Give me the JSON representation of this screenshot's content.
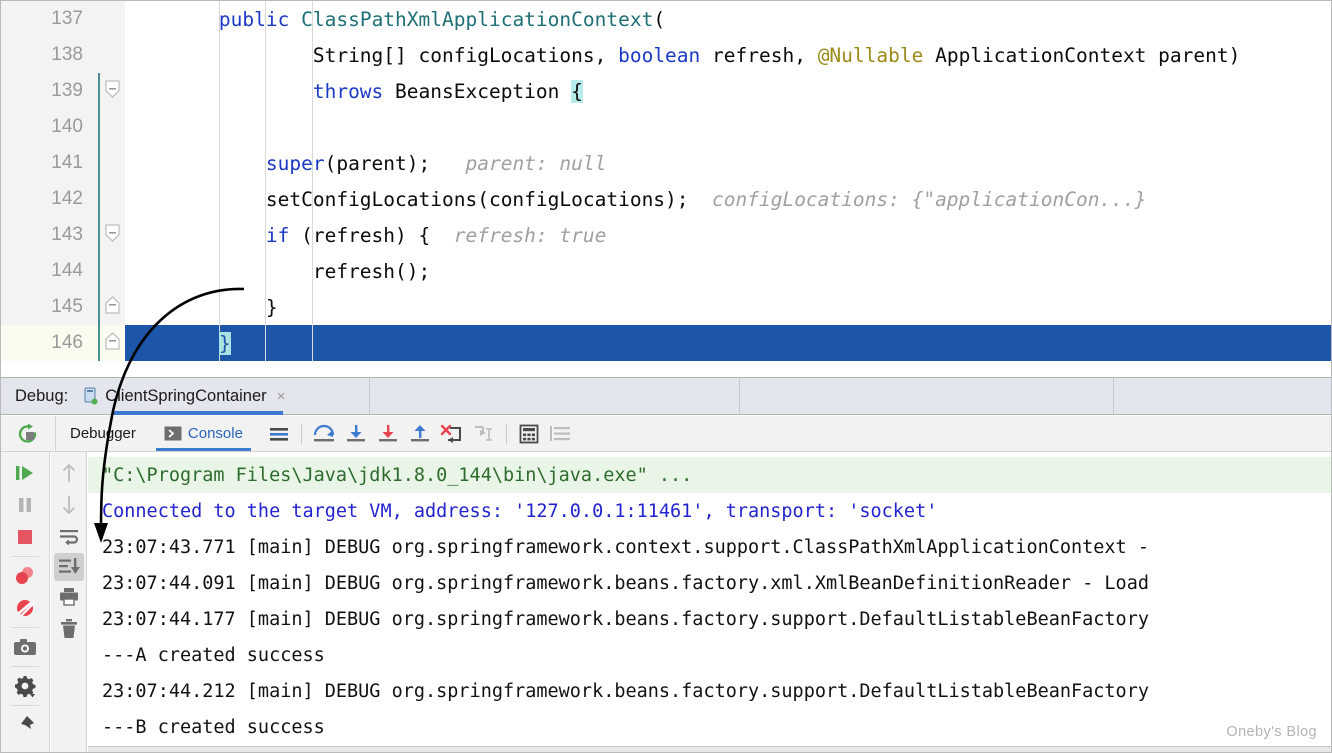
{
  "editor": {
    "lines": [
      {
        "num": "137",
        "fold": "none",
        "segments": [
          {
            "t": "        ",
            "c": "plain"
          },
          {
            "t": "public",
            "c": "kw"
          },
          {
            "t": " ",
            "c": "plain"
          },
          {
            "t": "ClassPathXmlApplicationContext",
            "c": "cls"
          },
          {
            "t": "(",
            "c": "plain"
          }
        ]
      },
      {
        "num": "138",
        "fold": "none",
        "segments": [
          {
            "t": "                ",
            "c": "plain"
          },
          {
            "t": "String[] configLocations, ",
            "c": "plain"
          },
          {
            "t": "boolean",
            "c": "kw"
          },
          {
            "t": " refresh, ",
            "c": "plain"
          },
          {
            "t": "@Nullable",
            "c": "ann"
          },
          {
            "t": " ApplicationContext parent)",
            "c": "plain"
          }
        ]
      },
      {
        "num": "139",
        "fold": "start",
        "segments": [
          {
            "t": "                ",
            "c": "plain"
          },
          {
            "t": "throws",
            "c": "kw"
          },
          {
            "t": " BeansException ",
            "c": "plain"
          },
          {
            "t": "{",
            "c": "brace-hl"
          }
        ]
      },
      {
        "num": "140",
        "fold": "none",
        "segments": [
          {
            "t": "",
            "c": "plain"
          }
        ]
      },
      {
        "num": "141",
        "fold": "none",
        "segments": [
          {
            "t": "            ",
            "c": "plain"
          },
          {
            "t": "super",
            "c": "kw"
          },
          {
            "t": "(parent);",
            "c": "plain"
          },
          {
            "t": "   parent: null",
            "c": "hint"
          }
        ]
      },
      {
        "num": "142",
        "fold": "none",
        "segments": [
          {
            "t": "            ",
            "c": "plain"
          },
          {
            "t": "setConfigLocations(configLocations);",
            "c": "plain"
          },
          {
            "t": "  configLocations: {\"applicationCon...}",
            "c": "hint"
          }
        ]
      },
      {
        "num": "143",
        "fold": "start",
        "segments": [
          {
            "t": "            ",
            "c": "plain"
          },
          {
            "t": "if",
            "c": "kw"
          },
          {
            "t": " (refresh) {",
            "c": "plain"
          },
          {
            "t": "  refresh: true",
            "c": "hint"
          }
        ]
      },
      {
        "num": "144",
        "fold": "none",
        "segments": [
          {
            "t": "                ",
            "c": "plain"
          },
          {
            "t": "refresh();",
            "c": "plain"
          }
        ]
      },
      {
        "num": "145",
        "fold": "end",
        "segments": [
          {
            "t": "            ",
            "c": "plain"
          },
          {
            "t": "}",
            "c": "plain"
          }
        ]
      },
      {
        "num": "146",
        "fold": "end",
        "selected": true,
        "segments": [
          {
            "t": "        ",
            "c": "plain"
          },
          {
            "t": "}",
            "c": "brace-hl"
          }
        ]
      }
    ]
  },
  "debug_tabbar": {
    "label": "Debug:",
    "tab": {
      "title": "ClientSpringContainer",
      "close": "×",
      "icon": "run-configuration-icon"
    }
  },
  "debug_toolbar": {
    "rerun_icon": "rerun-icon",
    "tabs": [
      {
        "label": "Debugger",
        "icon": "debugger-icon",
        "active": false
      },
      {
        "label": "Console",
        "icon": "console-icon",
        "active": true
      }
    ],
    "actions": [
      {
        "name": "show-line-breakpoints-icon",
        "tooltip": "Settings lines"
      },
      {
        "name": "step-over-icon",
        "tooltip": "Step Over"
      },
      {
        "name": "step-into-icon",
        "tooltip": "Step Into"
      },
      {
        "name": "force-step-into-icon",
        "tooltip": "Force Step Into"
      },
      {
        "name": "step-out-icon",
        "tooltip": "Step Out"
      },
      {
        "name": "drop-frame-icon",
        "tooltip": "Drop Frame"
      },
      {
        "name": "run-to-cursor-icon",
        "tooltip": "Run to Cursor"
      },
      {
        "name": "evaluate-expression-icon",
        "tooltip": "Evaluate Expression"
      },
      {
        "name": "layout-settings-icon",
        "tooltip": "Layout Settings"
      }
    ]
  },
  "sidebar_primary": [
    {
      "name": "resume-program-icon",
      "color": "#4fa94f"
    },
    {
      "name": "pause-program-icon",
      "color": "#b4b4b4"
    },
    {
      "name": "stop-program-icon",
      "color": "#e55561"
    },
    {
      "name": "view-breakpoints-icon",
      "color": "#e8434f"
    },
    {
      "name": "mute-breakpoints-icon",
      "color": "#e8434f"
    },
    {
      "name": "screenshot-icon",
      "color": "#6e6e6e"
    },
    {
      "name": "settings-gear-icon",
      "color": "#4a4a4a"
    },
    {
      "name": "pin-tab-icon",
      "color": "#4a4a4a"
    }
  ],
  "sidebar_secondary": [
    {
      "name": "up-arrow-icon",
      "selected": false
    },
    {
      "name": "down-arrow-icon",
      "selected": false
    },
    {
      "name": "soft-wrap-icon",
      "selected": false
    },
    {
      "name": "scroll-to-end-icon",
      "selected": true
    },
    {
      "name": "print-icon",
      "selected": false
    },
    {
      "name": "clear-all-icon",
      "selected": false
    }
  ],
  "console": {
    "lines": [
      {
        "kind": "cmd",
        "text": "\"C:\\Program Files\\Java\\jdk1.8.0_144\\bin\\java.exe\" ..."
      },
      {
        "kind": "info",
        "text": "Connected to the target VM, address: '127.0.0.1:11461', transport: 'socket'"
      },
      {
        "kind": "log",
        "text": "23:07:43.771 [main] DEBUG org.springframework.context.support.ClassPathXmlApplicationContext -"
      },
      {
        "kind": "log",
        "text": "23:07:44.091 [main] DEBUG org.springframework.beans.factory.xml.XmlBeanDefinitionReader - Load"
      },
      {
        "kind": "log",
        "text": "23:07:44.177 [main] DEBUG org.springframework.beans.factory.support.DefaultListableBeanFactory"
      },
      {
        "kind": "log",
        "text": "---A created success"
      },
      {
        "kind": "log",
        "text": "23:07:44.212 [main] DEBUG org.springframework.beans.factory.support.DefaultListableBeanFactory"
      },
      {
        "kind": "log",
        "text": "---B created success"
      }
    ]
  },
  "watermark": {
    "text": "Oneby's Blog"
  },
  "colors": {
    "keyword": "#1b39c4",
    "class": "#1f6f76",
    "annotation": "#9b8b1a",
    "hint": "#a0a0a0",
    "selection": "#1d55a8",
    "console_cmd_bg": "#e9f5e6",
    "console_cmd_fg": "#2e6b2e",
    "console_info": "#2323d0",
    "accent": "#3c7bd0"
  }
}
